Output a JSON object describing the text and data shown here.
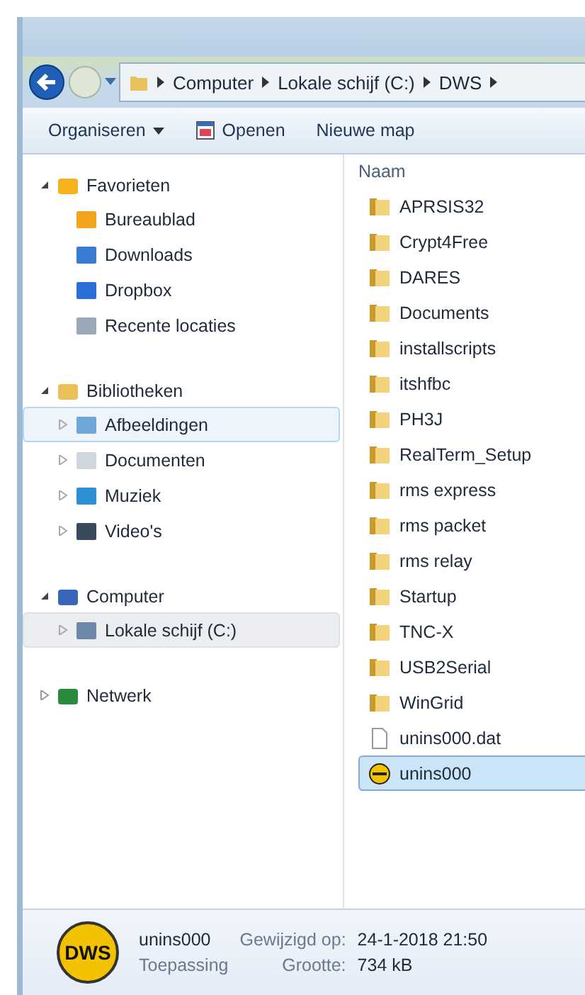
{
  "breadcrumb": [
    "Computer",
    "Lokale schijf (C:)",
    "DWS"
  ],
  "toolbar": [
    {
      "label": "Organiseren",
      "kind": "menu"
    },
    {
      "label": "Openen",
      "kind": "icon"
    },
    {
      "label": "Nieuwe map",
      "kind": "plain"
    }
  ],
  "nav": [
    {
      "label": "Favorieten",
      "expanded": true,
      "children": [
        {
          "label": "Bureaublad",
          "expandable": false,
          "selected": false,
          "hovered": false
        },
        {
          "label": "Downloads",
          "expandable": false,
          "selected": false,
          "hovered": false
        },
        {
          "label": "Dropbox",
          "expandable": false,
          "selected": false,
          "hovered": false
        },
        {
          "label": "Recente locaties",
          "expandable": false,
          "selected": false,
          "hovered": false
        }
      ]
    },
    {
      "label": "Bibliotheken",
      "expanded": true,
      "children": [
        {
          "label": "Afbeeldingen",
          "expandable": true,
          "selected": false,
          "hovered": true
        },
        {
          "label": "Documenten",
          "expandable": true,
          "selected": false,
          "hovered": false
        },
        {
          "label": "Muziek",
          "expandable": true,
          "selected": false,
          "hovered": false
        },
        {
          "label": "Video's",
          "expandable": true,
          "selected": false,
          "hovered": false
        }
      ]
    },
    {
      "label": "Computer",
      "expanded": true,
      "children": [
        {
          "label": "Lokale schijf (C:)",
          "expandable": true,
          "selected": true,
          "hovered": false
        }
      ]
    },
    {
      "label": "Netwerk",
      "expanded": false
    }
  ],
  "column_header": "Naam",
  "files": [
    {
      "name": "APRSIS32",
      "kind": "folder",
      "selected": false
    },
    {
      "name": "Crypt4Free",
      "kind": "folder",
      "selected": false
    },
    {
      "name": "DARES",
      "kind": "folder",
      "selected": false
    },
    {
      "name": "Documents",
      "kind": "folder",
      "selected": false
    },
    {
      "name": "installscripts",
      "kind": "folder",
      "selected": false
    },
    {
      "name": "itshfbc",
      "kind": "folder",
      "selected": false
    },
    {
      "name": "PH3J",
      "kind": "folder",
      "selected": false
    },
    {
      "name": "RealTerm_Setup",
      "kind": "folder",
      "selected": false
    },
    {
      "name": "rms express",
      "kind": "folder",
      "selected": false
    },
    {
      "name": "rms packet",
      "kind": "folder",
      "selected": false
    },
    {
      "name": "rms relay",
      "kind": "folder",
      "selected": false
    },
    {
      "name": "Startup",
      "kind": "folder",
      "selected": false
    },
    {
      "name": "TNC-X",
      "kind": "folder",
      "selected": false
    },
    {
      "name": "USB2Serial",
      "kind": "folder",
      "selected": false
    },
    {
      "name": "WinGrid",
      "kind": "folder",
      "selected": false
    },
    {
      "name": "unins000.dat",
      "kind": "file",
      "selected": false
    },
    {
      "name": "unins000",
      "kind": "app",
      "selected": true
    }
  ],
  "details": {
    "icon_text": "DWS",
    "name": "unins000",
    "type": "Toepassing",
    "modified_label": "Gewijzigd op:",
    "modified": "24-1-2018 21:50",
    "size_label": "Grootte:",
    "size": "734 kB"
  }
}
